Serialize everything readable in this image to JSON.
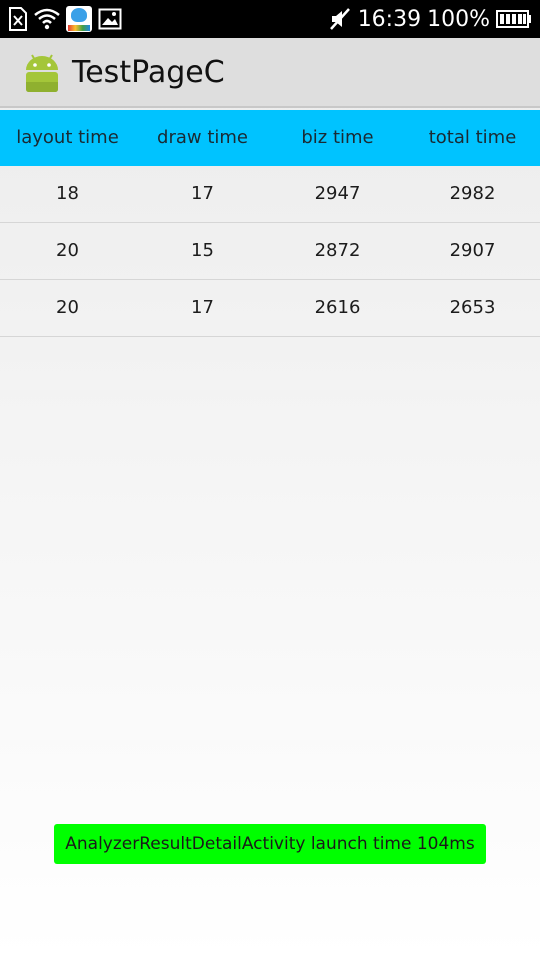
{
  "status_bar": {
    "time": "16:39",
    "battery": "100%",
    "icons": [
      "sim-missing-icon",
      "wifi-icon",
      "app-notification-icon",
      "gallery-icon",
      "mute-icon",
      "battery-icon"
    ]
  },
  "action_bar": {
    "title": "TestPageC",
    "icon": "android-icon"
  },
  "table": {
    "columns": [
      "layout time",
      "draw time",
      "biz time",
      "total time"
    ],
    "rows": [
      [
        "18",
        "17",
        "2947",
        "2982"
      ],
      [
        "20",
        "15",
        "2872",
        "2907"
      ],
      [
        "20",
        "17",
        "2616",
        "2653"
      ]
    ]
  },
  "toast": {
    "message": "AnalyzerResultDetailActivity launch time 104ms"
  },
  "colors": {
    "header_bg": "#00c3ff",
    "toast_bg": "#00ff00",
    "action_bar_bg": "#dedede",
    "status_bar_bg": "#000000"
  }
}
